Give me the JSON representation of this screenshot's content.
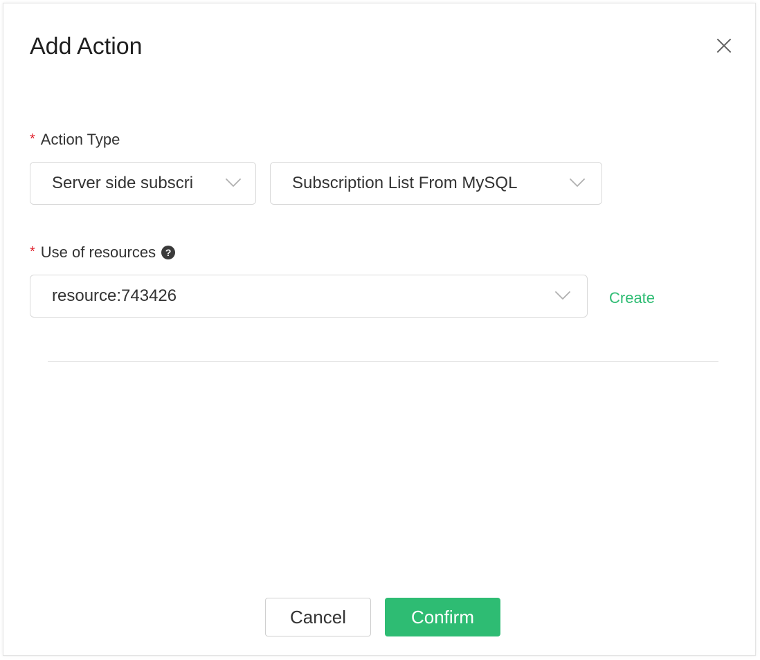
{
  "dialog": {
    "title": "Add Action"
  },
  "form": {
    "action_type": {
      "required_mark": "*",
      "label": "Action Type",
      "category_value": "Server side subscri",
      "type_value": "Subscription List From MySQL"
    },
    "resources": {
      "required_mark": "*",
      "label": "Use of resources",
      "help_glyph": "?",
      "value": "resource:743426",
      "create_label": "Create"
    }
  },
  "footer": {
    "cancel_label": "Cancel",
    "confirm_label": "Confirm"
  },
  "icons": {
    "close": "close-icon",
    "dropdown": "chevron-down-icon",
    "help": "help-icon"
  },
  "colors": {
    "accent": "#2ebc73",
    "required": "#e0202c",
    "border": "#d9d9d9",
    "text": "#333333"
  }
}
